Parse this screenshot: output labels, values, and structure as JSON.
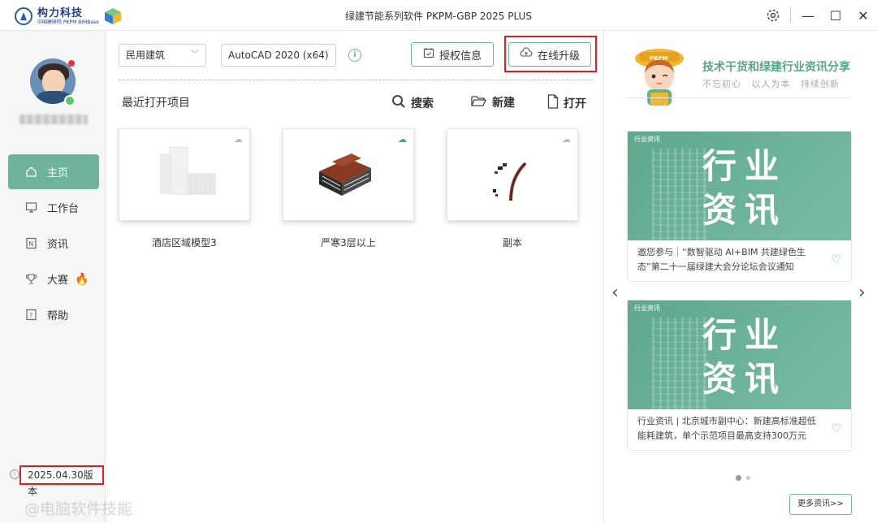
{
  "window": {
    "title": "绿建节能系列软件 PKPM-GBP 2025 PLUS",
    "logo_main": "构力科技",
    "logo_sub": "中国建研院 PKPM BIMBase"
  },
  "sidebar": {
    "items": [
      {
        "label": "主页",
        "icon": "home-icon",
        "active": true
      },
      {
        "label": "工作台",
        "icon": "monitor-icon"
      },
      {
        "label": "资讯",
        "icon": "news-icon"
      },
      {
        "label": "大赛",
        "icon": "trophy-icon",
        "badge": "fire-icon"
      },
      {
        "label": "帮助",
        "icon": "help-icon"
      }
    ],
    "version": "2025.04.30版本"
  },
  "toolbar": {
    "building_type": "民用建筑",
    "cad_version": "AutoCAD 2020 (x64)",
    "license_label": "授权信息",
    "upgrade_label": "在线升级"
  },
  "recent": {
    "title": "最近打开项目",
    "search_label": "搜索",
    "new_label": "新建",
    "open_label": "打开",
    "projects": [
      {
        "name": "酒店区域模型3",
        "cloud_synced": false
      },
      {
        "name": "严寒3层以上",
        "cloud_synced": true
      },
      {
        "name": "副本",
        "cloud_synced": false
      }
    ]
  },
  "news": {
    "heading": "技术干货和绿建行业资讯分享",
    "slogans": [
      "不忘初心",
      "以人为本",
      "持续创新"
    ],
    "cards": [
      {
        "tag": "行业资讯",
        "banner": "行业资讯",
        "text": "邀您参与｜“数智驱动 AI+BIM 共建绿色生态”第二十一届绿建大会分论坛会议通知"
      },
      {
        "tag": "行业资讯",
        "banner": "行业资讯",
        "text": "行业资讯 | 北京城市副中心：新建高标准超低能耗建筑，单个示范项目最高支持300万元"
      }
    ],
    "more_label": "更多资讯>>"
  },
  "watermark": "@电脑软件技能",
  "colors": {
    "accent": "#6fb39c",
    "highlight": "#e02020"
  }
}
